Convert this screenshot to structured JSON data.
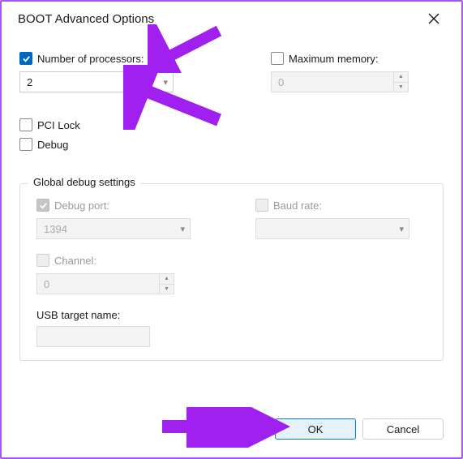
{
  "window": {
    "title": "BOOT Advanced Options"
  },
  "numProcessors": {
    "label": "Number of processors:",
    "value": "2"
  },
  "maxMemory": {
    "label": "Maximum memory:",
    "value": "0"
  },
  "pciLock": {
    "label": "PCI Lock"
  },
  "debug": {
    "label": "Debug"
  },
  "globalDebug": {
    "legend": "Global debug settings",
    "debugPort": {
      "label": "Debug port:",
      "value": "1394"
    },
    "baudRate": {
      "label": "Baud rate:",
      "value": ""
    },
    "channel": {
      "label": "Channel:",
      "value": "0"
    },
    "usbTarget": {
      "label": "USB target name:"
    }
  },
  "buttons": {
    "ok": "OK",
    "cancel": "Cancel"
  }
}
